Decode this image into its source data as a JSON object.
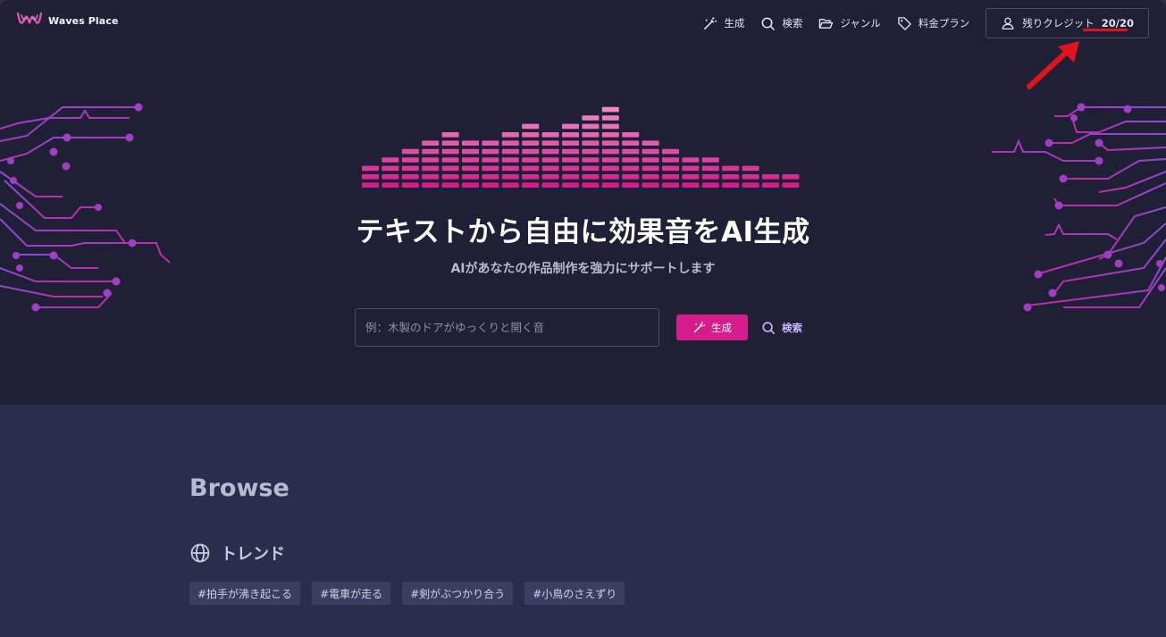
{
  "app": {
    "name": "Waves Place",
    "brand_color": "#d61d8c"
  },
  "nav": {
    "generate": {
      "label": "生成",
      "icon": "magic-wand-icon"
    },
    "search": {
      "label": "検索",
      "icon": "search-icon"
    },
    "genre": {
      "label": "ジャンル",
      "icon": "folder-open-icon"
    },
    "pricing": {
      "label": "料金プラン",
      "icon": "tag-icon"
    },
    "credits": {
      "label": "残りクレジット",
      "count": "20/20",
      "icon": "user-icon"
    }
  },
  "hero": {
    "title": "テキストから自由に効果音をAI生成",
    "subtitle": "AIがあなたの作品制作を強力にサポートします",
    "search_placeholder": "例：木製のドアがゆっくりと開く音",
    "generate_label": "生成",
    "search_label": "検索"
  },
  "browse": {
    "title": "Browse",
    "trend_label": "トレンド",
    "tags": [
      "#拍手が沸き起こる",
      "#電車が走る",
      "#剣がぶつかり合う",
      "#小鳥のさえずり"
    ]
  },
  "annotation": {
    "color": "#e0141c"
  }
}
